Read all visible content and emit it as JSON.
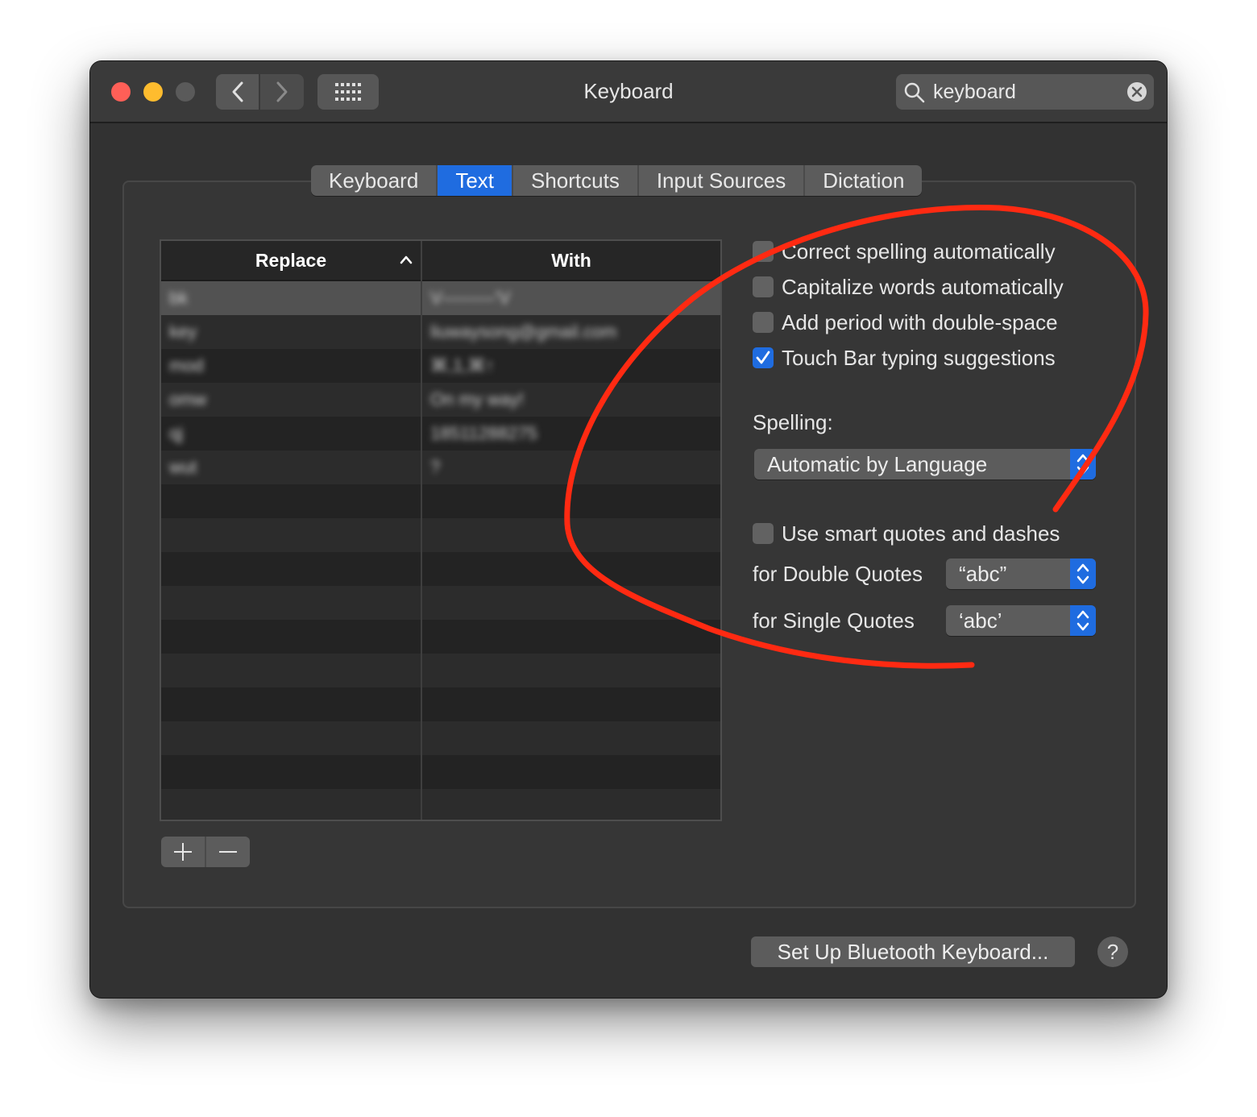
{
  "window": {
    "title": "Keyboard"
  },
  "search": {
    "value": "keyboard"
  },
  "tabs": [
    {
      "label": "Keyboard",
      "active": false
    },
    {
      "label": "Text",
      "active": true
    },
    {
      "label": "Shortcuts",
      "active": false
    },
    {
      "label": "Input Sources",
      "active": false
    },
    {
      "label": "Dictation",
      "active": false
    }
  ],
  "table": {
    "headers": {
      "replace": "Replace",
      "with": "With"
    },
    "rows": [
      {
        "replace": "bk",
        "with": "V———'V"
      },
      {
        "replace": "key",
        "with": "liuwaysong@gmail.com"
      },
      {
        "replace": "mod",
        "with": "⌘,1,⌘↑"
      },
      {
        "replace": "omw",
        "with": "On my way!"
      },
      {
        "replace": "qj",
        "with": "18511288275"
      },
      {
        "replace": "wut",
        "with": "?"
      }
    ]
  },
  "options": [
    {
      "label": "Correct spelling automatically",
      "checked": false
    },
    {
      "label": "Capitalize words automatically",
      "checked": false
    },
    {
      "label": "Add period with double-space",
      "checked": false
    },
    {
      "label": "Touch Bar typing suggestions",
      "checked": true
    }
  ],
  "spelling": {
    "label": "Spelling:",
    "value": "Automatic by Language"
  },
  "smart_quotes": {
    "label": "Use smart quotes and dashes",
    "checked": false,
    "double_label": "for Double Quotes",
    "double_value": "“abc”",
    "single_label": "for Single Quotes",
    "single_value": "‘abc’"
  },
  "buttons": {
    "bluetooth": "Set Up Bluetooth Keyboard...",
    "help": "?"
  },
  "colors": {
    "accent": "#1f6ce0",
    "annotation": "#ff2a12",
    "window_bg": "#323232"
  }
}
